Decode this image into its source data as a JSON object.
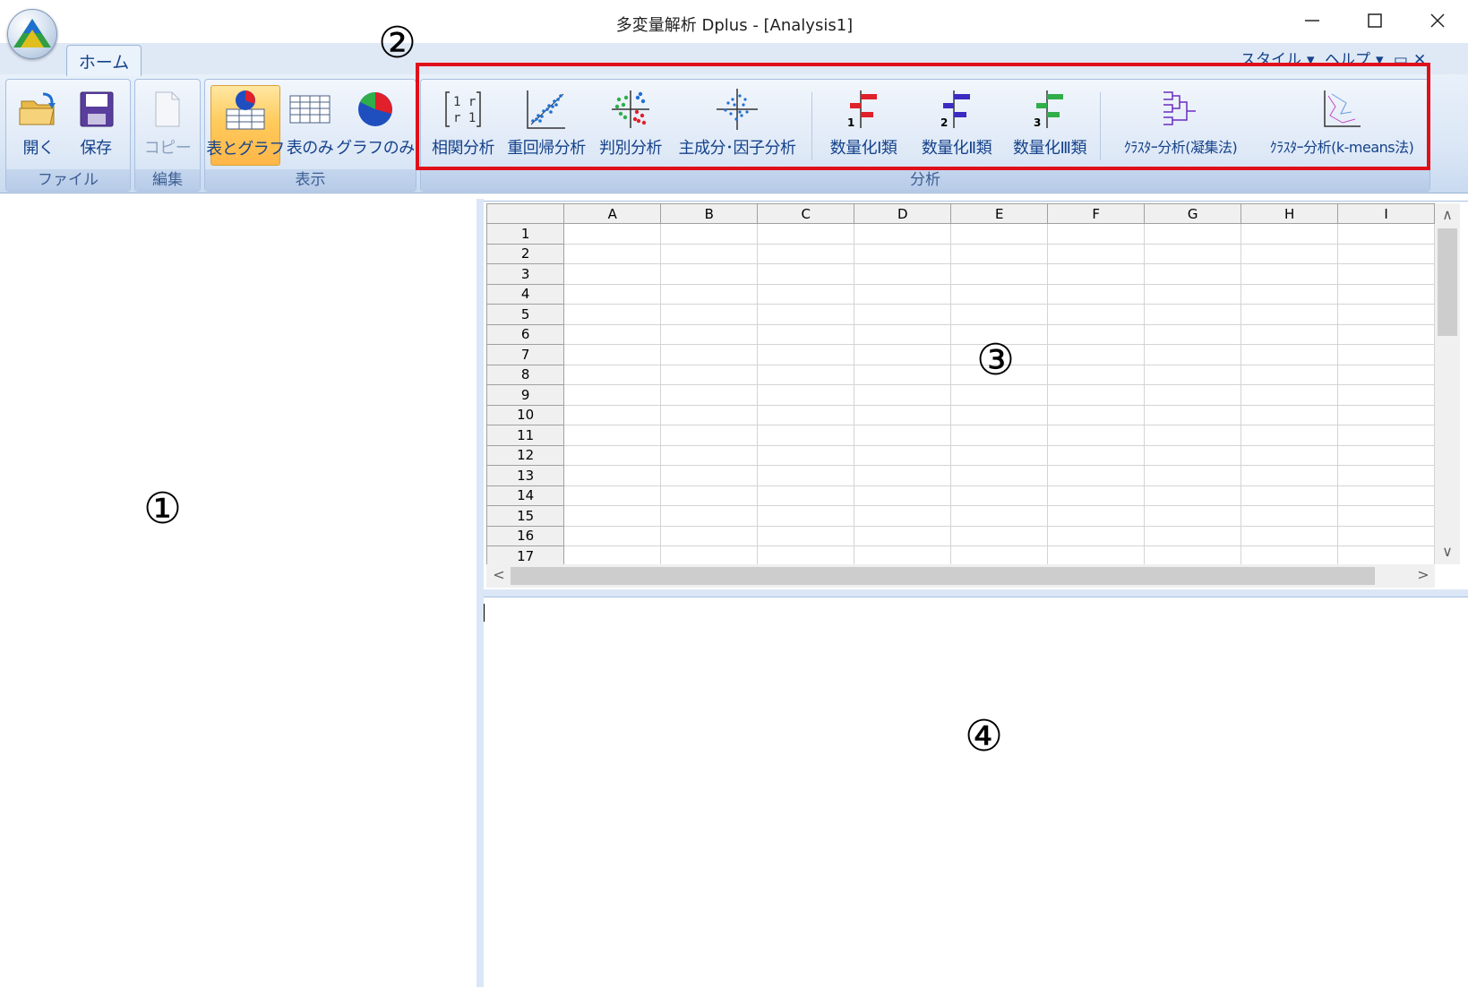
{
  "window": {
    "title": "多変量解析 Dplus - [Analysis1]"
  },
  "tabs": {
    "home": "ホーム"
  },
  "menu_right": {
    "style": "スタイル",
    "help": "ヘルプ"
  },
  "groups": {
    "file": {
      "label": "ファイル",
      "buttons": [
        {
          "label": "開く",
          "icon": "open-folder-icon"
        },
        {
          "label": "保存",
          "icon": "save-disk-icon"
        }
      ]
    },
    "edit": {
      "label": "編集",
      "buttons": [
        {
          "label": "コピー",
          "icon": "copy-page-icon",
          "disabled": true
        }
      ]
    },
    "view": {
      "label": "表示",
      "buttons": [
        {
          "label": "表とグラフ",
          "icon": "table-chart-icon",
          "active": true
        },
        {
          "label": "表のみ",
          "icon": "table-icon"
        },
        {
          "label": "グラフのみ",
          "icon": "pie-chart-icon"
        }
      ]
    },
    "analysis": {
      "label": "分析",
      "buttons": [
        {
          "label": "相関分析",
          "icon": "correlation-matrix-icon"
        },
        {
          "label": "重回帰分析",
          "icon": "regression-scatter-icon"
        },
        {
          "label": "判別分析",
          "icon": "discriminant-icon"
        },
        {
          "label": "主成分･因子分析",
          "icon": "principal-component-icon"
        },
        {
          "label": "数量化Ⅰ類",
          "icon": "quantification-1-icon"
        },
        {
          "label": "数量化Ⅱ類",
          "icon": "quantification-2-icon"
        },
        {
          "label": "数量化Ⅲ類",
          "icon": "quantification-3-icon"
        },
        {
          "label": "ｸﾗｽﾀｰ分析(凝集法)",
          "icon": "dendrogram-icon"
        },
        {
          "label": "ｸﾗｽﾀｰ分析(k-means法)",
          "icon": "kmeans-icon"
        }
      ]
    }
  },
  "annotations": [
    "①",
    "②",
    "③",
    "④"
  ],
  "sheet": {
    "columns": [
      "A",
      "B",
      "C",
      "D",
      "E",
      "F",
      "G",
      "H",
      "I"
    ],
    "rows": [
      "1",
      "2",
      "3",
      "4",
      "5",
      "6",
      "7",
      "8",
      "9",
      "10",
      "11",
      "12",
      "13",
      "14",
      "15",
      "16",
      "17"
    ]
  },
  "scroll": {
    "up": "∧",
    "down": "∨",
    "left": "<",
    "right": ">"
  }
}
